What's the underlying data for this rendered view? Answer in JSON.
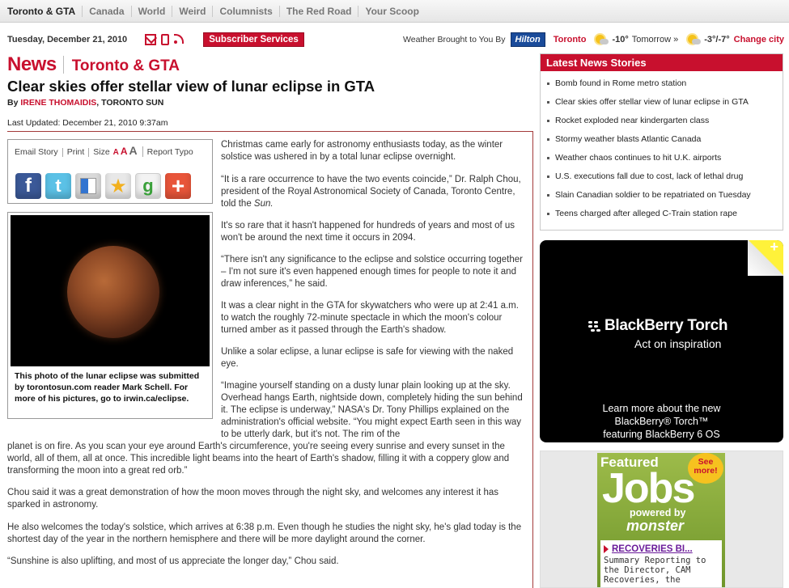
{
  "nav": {
    "items": [
      "Toronto & GTA",
      "Canada",
      "World",
      "Weird",
      "Columnists",
      "The Red Road",
      "Your Scoop"
    ]
  },
  "header": {
    "date": "Tuesday, December 21, 2010",
    "subscriber_label": "Subscriber Services",
    "weather": {
      "sponsor_text": "Weather Brought to You By",
      "sponsor_name": "Hilton",
      "city": "Toronto",
      "today_temp": "-10°",
      "tomorrow_label": "Tomorrow »",
      "tomorrow_temp": "-3°/-7°",
      "change_city": "Change city"
    }
  },
  "article": {
    "section": "News",
    "subsection": "Toronto & GTA",
    "headline": "Clear skies offer stellar view of lunar eclipse in GTA",
    "by_prefix": "By",
    "author": "IRENE THOMAIDIS",
    "outlet": ", TORONTO SUN",
    "updated": "Last Updated: December 21, 2010 9:37am",
    "tools": {
      "email": "Email Story",
      "print": "Print",
      "size": "Size",
      "report": "Report Typo"
    },
    "caption": "This photo of the lunar eclipse was submitted by torontosun.com reader Mark Schell. For more of his pictures, go to irwin.ca/eclipse.",
    "p1": "Christmas came early for astronomy enthusiasts today, as the winter solstice was ushered in by a total lunar eclipse overnight.",
    "p2_a": "“It is a rare occurrence to have the two events coincide,” Dr. Ralph Chou, president of the Royal Astronomical Society of Canada, Toronto Centre, told the ",
    "p2_b": "Sun.",
    "p3": "It's so rare that it hasn't happened for hundreds of years and most of us won't be around the next time it occurs in 2094.",
    "p4": "“There isn't any significance to the eclipse and solstice occurring together – I'm not sure it's even happened enough times for people to note it and draw inferences,” he said.",
    "p5": "It was a clear night in the GTA for skywatchers who were up at 2:41 a.m. to watch the roughly 72-minute spectacle in which the moon's colour turned amber as it passed through the Earth's shadow.",
    "p6": "Unlike a solar eclipse, a lunar eclipse is safe for viewing with the naked eye.",
    "p7_top": "“Imagine yourself standing on a dusty lunar plain looking up at the sky. Overhead hangs Earth, nightside down, completely hiding the sun behind it. The eclipse is underway,” NASA's Dr. Tony Phillips explained on the administration's official website. “You might expect Earth seen in this way to be utterly dark, but it's not. The rim of the",
    "p7_bottom": "planet is on fire. As you scan your eye around Earth's circumference, you're seeing every sunrise and every sunset in the world, all of them, all at once. This incredible light beams into the heart of Earth's shadow, filling it with a coppery glow and transforming the moon into a great red orb.”",
    "p8": "Chou said it was a great demonstration of how the moon moves through the night sky, and welcomes any interest it has sparked in astronomy.",
    "p9": "He also welcomes the today's solstice, which arrives at 6:38 p.m. Even though he studies the night sky, he's glad today is the shortest day of the year in the northern hemisphere and there will be more daylight around the corner.",
    "p10": "“Sunshine is also uplifting, and most of us appreciate the longer day,” Chou said."
  },
  "latest": {
    "title": "Latest News Stories",
    "items": [
      "Bomb found in Rome metro station",
      "Clear skies offer stellar view of lunar eclipse in GTA",
      "Rocket exploded near kindergarten class",
      "Stormy weather blasts Atlantic Canada",
      "Weather chaos continues to hit U.K. airports",
      "U.S. executions fall due to cost, lack of lethal drug",
      "Slain Canadian soldier to be repatriated on Tuesday",
      "Teens charged after alleged C-Train station rape"
    ]
  },
  "ad": {
    "brand": "BlackBerry Torch",
    "tagline": "Act on inspiration",
    "learn_1": "Learn more about the new",
    "learn_2": "BlackBerry® Torch™",
    "learn_3": "featuring BlackBerry 6 OS"
  },
  "jobs": {
    "featured": "Featured",
    "see_more_1": "See",
    "see_more_2": "more!",
    "jobs_word": "Jobs",
    "powered_by": "powered by",
    "monster": "monster",
    "job_title": "RECOVERIES BI...",
    "job_desc_1": "Summary Reporting to",
    "job_desc_2": "the Director, CAM",
    "job_desc_3": "Recoveries, the"
  },
  "colors": {
    "accent": "#c8102e",
    "hilton": "#1a4b9a"
  }
}
